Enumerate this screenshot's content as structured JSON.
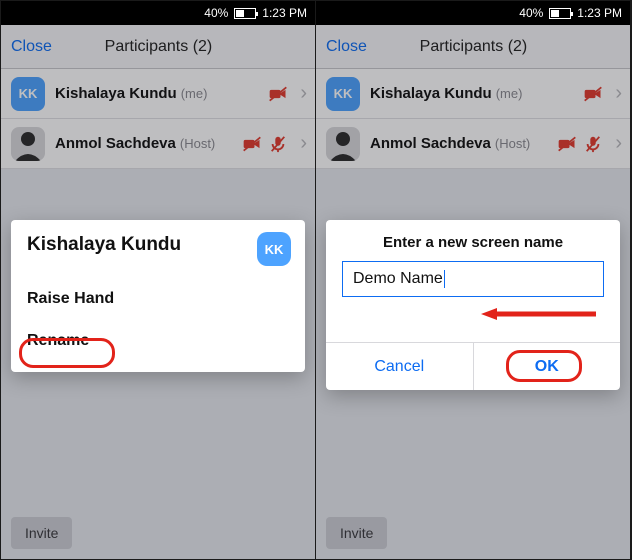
{
  "statusbar": {
    "battery": "40%",
    "time": "1:23 PM"
  },
  "header": {
    "close": "Close",
    "title": "Participants (2)"
  },
  "participants": [
    {
      "initials": "KK",
      "name": "Kishalaya Kundu",
      "suffix": "(me)",
      "video_off": true,
      "mic_off": false
    },
    {
      "initials": "",
      "name": "Anmol Sachdeva",
      "suffix": "(Host)",
      "video_off": true,
      "mic_off": true
    }
  ],
  "invite_label": "Invite",
  "action_sheet": {
    "name": "Kishalaya Kundu",
    "initials": "KK",
    "items": {
      "raise_hand": "Raise Hand",
      "rename": "Rename"
    }
  },
  "rename_dialog": {
    "title": "Enter a new screen name",
    "value": "Demo Name",
    "cancel": "Cancel",
    "ok": "OK"
  }
}
